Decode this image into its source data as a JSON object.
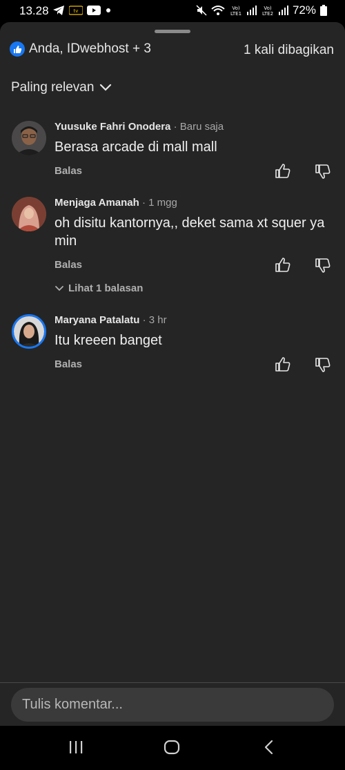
{
  "status_bar": {
    "time": "13.28",
    "battery_percent": "72%",
    "app_icons": [
      "telegram-icon",
      "app-badge-icon",
      "youtube-icon",
      "dot-icon"
    ],
    "system_icons": [
      "mute-icon",
      "wifi-icon",
      "volte-lte1-icon",
      "signal-icon",
      "volte-lte2-icon",
      "signal-icon",
      "battery-icon"
    ]
  },
  "header": {
    "reactions_text": "Anda, IDwebhost + 3",
    "shares_text": "1 kali dibagikan",
    "sort_label": "Paling relevan"
  },
  "comments": [
    {
      "name": "Yuusuke Fahri Onodera",
      "time": "· Baru saja",
      "text": "Berasa arcade di mall mall",
      "reply_label": "Balas"
    },
    {
      "name": "Menjaga Amanah",
      "time": "· 1 mgg",
      "text": "oh disitu kantornya,, deket sama xt squer ya min",
      "reply_label": "Balas",
      "view_replies": "Lihat 1 balasan"
    },
    {
      "name": "Maryana Patalatu",
      "time": "· 3 hr",
      "text": "Itu kreeen banget",
      "reply_label": "Balas"
    }
  ],
  "composer": {
    "placeholder": "Tulis komentar..."
  },
  "nav": {
    "icons": [
      "recent-apps-icon",
      "home-icon",
      "back-icon"
    ]
  },
  "colors": {
    "sheet_bg": "#252525",
    "accent_blue": "#1877f2",
    "text_primary": "#e6e6e6",
    "text_secondary": "#a8a8a8"
  }
}
